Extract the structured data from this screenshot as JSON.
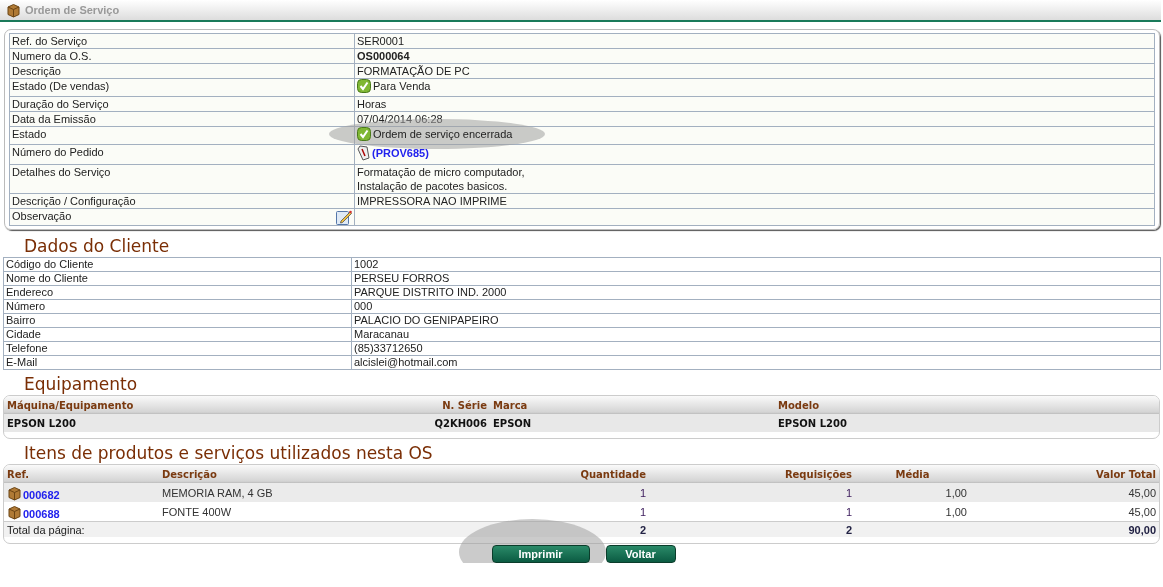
{
  "header": {
    "title": "Ordem de Serviço"
  },
  "service": [
    {
      "kind": "text",
      "label": "Ref. do Serviço",
      "value": "SER0001",
      "highlighted": false
    },
    {
      "kind": "bold",
      "label": "Numero da O.S.",
      "value": "OS000064",
      "highlighted": false
    },
    {
      "kind": "text",
      "label": "Descrição",
      "value": "FORMATAÇÃO DE PC",
      "highlighted": false
    },
    {
      "kind": "status",
      "label": "Estado (De vendas)",
      "value": "Para Venda",
      "highlighted": false
    },
    {
      "kind": "text",
      "label": "Duração do Serviço",
      "value": "Horas",
      "highlighted": false
    },
    {
      "kind": "text",
      "label": "Data da Emissão",
      "value": "07/04/2014 06:28",
      "highlighted": false
    },
    {
      "kind": "status",
      "label": "Estado",
      "value": "Ordem de serviço encerrada",
      "highlighted": true
    },
    {
      "kind": "link",
      "label": "Número do Pedido",
      "value": "(PROV685)",
      "highlighted": false
    },
    {
      "kind": "multiline",
      "label": "Detalhes do Serviço",
      "lines": [
        "Formatação de micro computador,",
        "Instalação de pacotes basicos."
      ],
      "highlighted": false
    },
    {
      "kind": "text",
      "label": "Descrição / Configuração",
      "value": "IMPRESSORA NAO IMPRIME",
      "highlighted": false
    },
    {
      "kind": "edit",
      "label": "Observação",
      "highlighted": false
    }
  ],
  "client": {
    "title": "Dados do Cliente",
    "rows": [
      {
        "label": "Código do Cliente",
        "value": "1002"
      },
      {
        "label": "Nome do Cliente",
        "value": "PERSEU FORROS"
      },
      {
        "label": "Endereco",
        "value": "PARQUE DISTRITO IND. 2000"
      },
      {
        "label": "Número",
        "value": "000"
      },
      {
        "label": "Bairro",
        "value": "PALACIO DO GENIPAPEIRO"
      },
      {
        "label": "Cidade",
        "value": "Maracanau"
      },
      {
        "label": "Telefone",
        "value": "(85)33712650"
      },
      {
        "label": "E-Mail",
        "value": "alcislei@hotmail.com"
      }
    ]
  },
  "equipment": {
    "title": "Equipamento",
    "columns": [
      "Máquina/Equipamento",
      "N. Série",
      "Marca",
      "Modelo"
    ],
    "rows": [
      [
        "EPSON L200",
        "Q2KH006",
        "EPSON",
        "EPSON L200"
      ]
    ]
  },
  "items": {
    "title": "Itens de produtos e serviços utilizados nesta OS",
    "columns": [
      "Ref.",
      "Descrição",
      "Quantidade",
      "Requisições",
      "Média",
      "Valor Total"
    ],
    "rows": [
      {
        "ref": "000682",
        "description": "MEMORIA RAM, 4 GB",
        "quantity": "1",
        "requests": "1",
        "average": "1,00",
        "total": "45,00"
      },
      {
        "ref": "000688",
        "description": "FONTE 400W",
        "quantity": "1",
        "requests": "1",
        "average": "1,00",
        "total": "45,00"
      }
    ],
    "footer": {
      "label": "Total da página:",
      "quantity": "2",
      "requests": "2",
      "total": "90,00"
    }
  },
  "buttons": [
    {
      "label": "Imprimir",
      "highlighted": true
    },
    {
      "label": "Voltar",
      "highlighted": false
    }
  ]
}
